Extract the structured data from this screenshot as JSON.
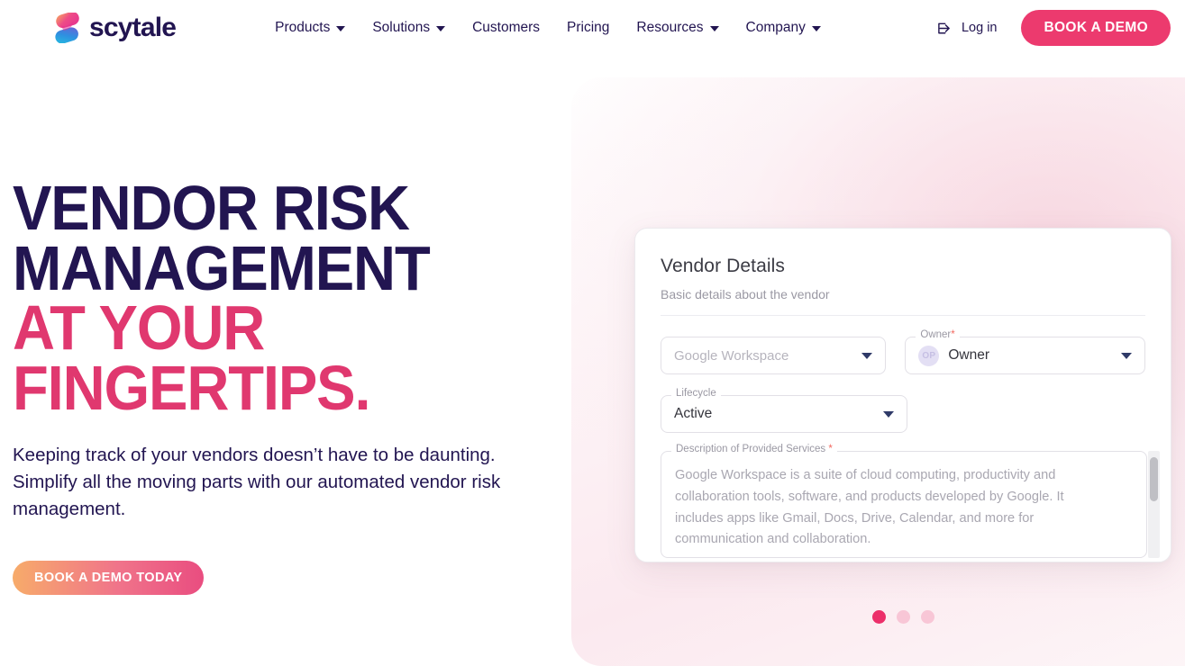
{
  "header": {
    "brand_name": "scytale",
    "brand_icon": "scytale-s-logo",
    "nav": [
      {
        "label": "Products",
        "has_caret": true
      },
      {
        "label": "Solutions",
        "has_caret": true
      },
      {
        "label": "Customers",
        "has_caret": false
      },
      {
        "label": "Pricing",
        "has_caret": false
      },
      {
        "label": "Resources",
        "has_caret": true
      },
      {
        "label": "Company",
        "has_caret": true
      }
    ],
    "login_label": "Log in",
    "login_icon": "login-arrow-icon",
    "demo_button_label": "BOOK A DEMO"
  },
  "hero": {
    "headline_lines": [
      {
        "text": "VENDOR RISK",
        "color": "dark"
      },
      {
        "text": "MANAGEMENT",
        "color": "dark"
      },
      {
        "text": "AT YOUR",
        "color": "pink"
      },
      {
        "text": "FINGERTIPS.",
        "color": "pink"
      }
    ],
    "subtitle": "Keeping track of your vendors doesn’t have to be daunting. Simplify all the moving parts with our automated vendor risk management.",
    "cta_label": "BOOK A DEMO TODAY"
  },
  "vendor_card": {
    "title": "Vendor Details",
    "subtitle": "Basic details about the vendor",
    "vendor_field": {
      "placeholder": "Google Workspace",
      "caret_icon": "chevron-down-icon"
    },
    "owner_field": {
      "legend": "Owner",
      "required_mark": "*",
      "avatar_initials": "OP",
      "value": "Owner",
      "caret_icon": "chevron-down-icon"
    },
    "lifecycle_field": {
      "legend": "Lifecycle",
      "value": "Active",
      "caret_icon": "chevron-down-icon"
    },
    "description_field": {
      "legend": "Description of Provided Services",
      "required_mark": "*",
      "value": "Google Workspace is a suite of cloud computing, productivity and collaboration tools, software, and products developed by Google. It includes apps like Gmail, Docs, Drive, Calendar, and more for communication and collaboration."
    }
  },
  "carousel": {
    "slides": 3,
    "active_index": 0
  },
  "colors": {
    "brand_navy": "#221551",
    "brand_pink": "#ec3a6e",
    "headline_pink": "#e0386f",
    "cta_gradient_from": "#f7ab6a",
    "cta_gradient_to": "#e94d80",
    "dot_active": "#ec2f6a",
    "dot_inactive": "#f8c6d6",
    "required_asterisk": "#f2685f"
  }
}
